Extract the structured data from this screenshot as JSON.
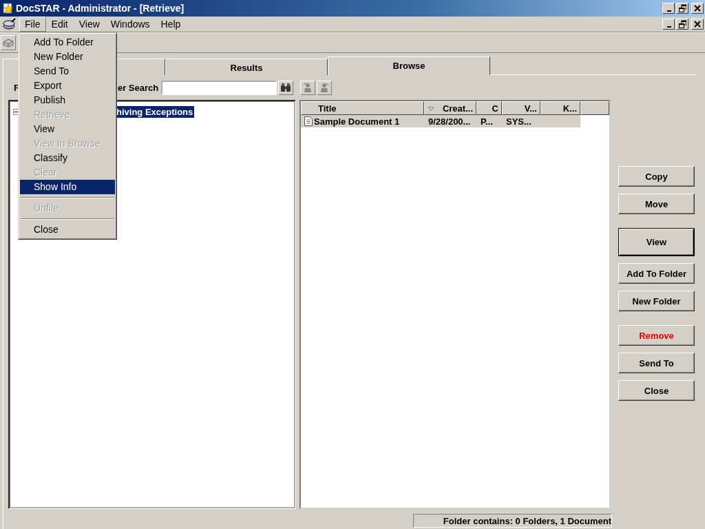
{
  "window": {
    "title": "DocSTAR - Administrator - [Retrieve]"
  },
  "menu_bar": [
    {
      "label": "File",
      "selected": true
    },
    {
      "label": "Edit",
      "selected": false
    },
    {
      "label": "View",
      "selected": false
    },
    {
      "label": "Windows",
      "selected": false
    },
    {
      "label": "Help",
      "selected": false
    }
  ],
  "file_menu": [
    {
      "kind": "item",
      "label": "Add To Folder",
      "disabled": false,
      "selected": false
    },
    {
      "kind": "item",
      "label": "New Folder",
      "disabled": false,
      "selected": false
    },
    {
      "kind": "item",
      "label": "Send To",
      "disabled": false,
      "selected": false
    },
    {
      "kind": "item",
      "label": "Export",
      "disabled": false,
      "selected": false
    },
    {
      "kind": "item",
      "label": "Publish",
      "disabled": false,
      "selected": false
    },
    {
      "kind": "item",
      "label": "Retrieve",
      "disabled": true,
      "selected": false
    },
    {
      "kind": "item",
      "label": "View",
      "disabled": false,
      "selected": false
    },
    {
      "kind": "item",
      "label": "View In Browse",
      "disabled": true,
      "selected": false
    },
    {
      "kind": "item",
      "label": "Classify",
      "disabled": false,
      "selected": false
    },
    {
      "kind": "item",
      "label": "Clear",
      "disabled": true,
      "selected": false
    },
    {
      "kind": "item",
      "label": "Show Info",
      "disabled": false,
      "selected": true
    },
    {
      "kind": "separator"
    },
    {
      "kind": "item",
      "label": "Unfile",
      "disabled": true,
      "selected": false
    },
    {
      "kind": "separator"
    },
    {
      "kind": "item",
      "label": "Close",
      "disabled": false,
      "selected": false
    }
  ],
  "tabs": [
    {
      "selected": false
    },
    {
      "label": "Results",
      "selected": false
    },
    {
      "label": "Browse",
      "selected": true
    }
  ],
  "search": {
    "partial_label": "F",
    "label": "er Search"
  },
  "tree": {
    "items": [
      {
        "label": "hiving Exceptions",
        "selected": true
      }
    ]
  },
  "results": {
    "columns": [
      {
        "label": "Title",
        "sorted": false
      },
      {
        "label": "Creat...",
        "sorted": true
      },
      {
        "label": "C",
        "sorted": false
      },
      {
        "label": "V...",
        "sorted": false
      },
      {
        "label": "K...",
        "sorted": false
      }
    ],
    "rows": [
      {
        "cells": [
          "Sample Document 1",
          "9/28/200...",
          "P...",
          "SYS..."
        ],
        "selected": true
      }
    ]
  },
  "buttons": [
    {
      "label": "Copy",
      "kind": "normal"
    },
    {
      "label": "Move",
      "kind": "normal"
    },
    {
      "label": "View",
      "kind": "default"
    },
    {
      "label": "Add To Folder",
      "kind": "normal"
    },
    {
      "label": "New Folder",
      "kind": "normal"
    },
    {
      "label": "Remove",
      "kind": "danger"
    },
    {
      "label": "Send To",
      "kind": "normal"
    },
    {
      "label": "Close",
      "kind": "normal"
    }
  ],
  "status_bar": {
    "text": "Folder contains: 0 Folders, 1 Document"
  }
}
